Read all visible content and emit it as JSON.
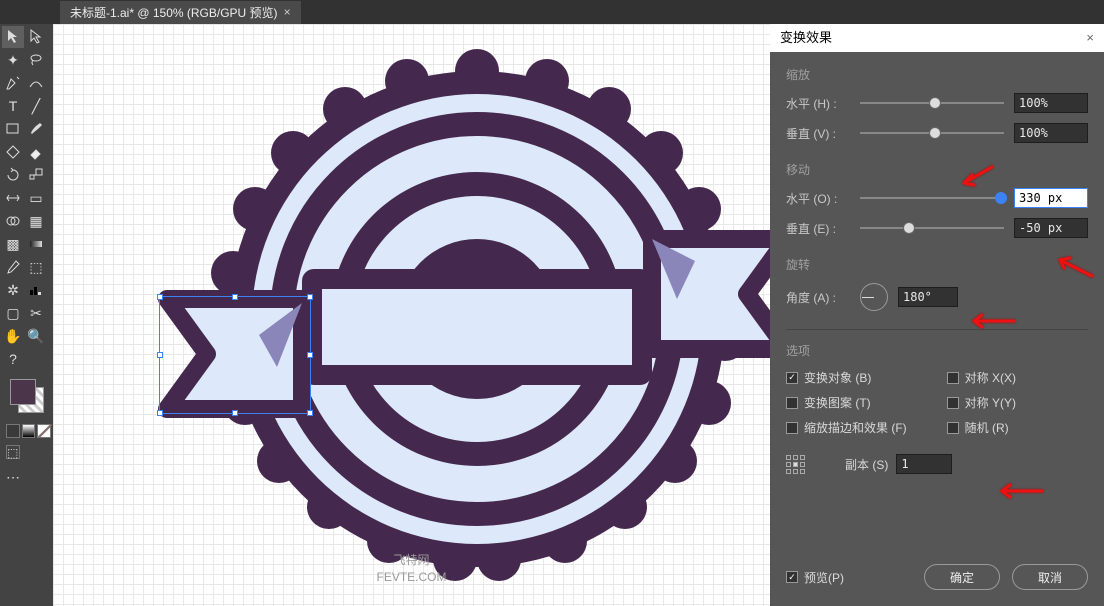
{
  "tab": {
    "title": "未标题-1.ai* @ 150% (RGB/GPU 预览)"
  },
  "panel": {
    "title": "变换效果",
    "scale": {
      "label": "缩放",
      "h_label": "水平 (H) :",
      "h_value": "100%",
      "v_label": "垂直 (V) :",
      "v_value": "100%"
    },
    "move": {
      "label": "移动",
      "h_label": "水平 (O) :",
      "h_value": "330 px",
      "v_label": "垂直 (E) :",
      "v_value": "-50 px"
    },
    "rotate": {
      "label": "旋转",
      "a_label": "角度 (A) :",
      "a_value": "180°"
    },
    "options": {
      "label": "选项",
      "transform_object": "变换对象 (B)",
      "transform_pattern": "变换图案 (T)",
      "scale_strokes": "缩放描边和效果 (F)",
      "mirror_x": "对称 X(X)",
      "mirror_y": "对称 Y(Y)",
      "random": "随机 (R)"
    },
    "copies": {
      "label": "副本 (S)",
      "value": "1"
    },
    "preview": "预览(P)",
    "ok": "确定",
    "cancel": "取消"
  },
  "watermark": {
    "line1": "飞特网",
    "line2": "FEVTE.COM"
  },
  "colors": {
    "badge_dark": "#45284e",
    "badge_light": "#dde9fa",
    "ribbon_accent": "#8b86b9"
  }
}
